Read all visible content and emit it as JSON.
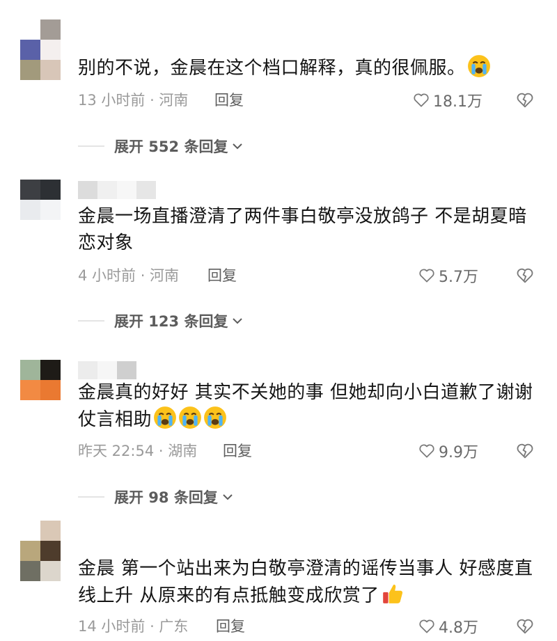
{
  "comments": [
    {
      "text": "别的不说，金晨在这个档口解释，真的很佩服。",
      "emojis": [
        "crying-face"
      ],
      "meta": "13 小时前 · 河南",
      "reply_label": "回复",
      "likes": "18.1万",
      "expand_label": "展开 552 条回复",
      "avatar_colors": [
        "#ffffff",
        "#a39c96",
        "#5a61a8",
        "#f4efee",
        "#a29a7c",
        "#d8c6b8"
      ]
    },
    {
      "text": "金晨一场直播澄清了两件事白敬亭没放鸽子 不是胡夏暗恋对象",
      "emojis": [],
      "meta": "4 小时前 · 河南",
      "reply_label": "回复",
      "likes": "5.7万",
      "expand_label": "展开 123 条回复",
      "avatar_colors": [
        "#3d3f43",
        "#2d3034",
        "#e9ebee",
        "#1b1e24"
      ]
    },
    {
      "text": "金晨真的好好 其实不关她的事 但她却向小白道歉了谢谢仗言相助",
      "emojis": [
        "crying-face",
        "crying-face",
        "crying-face"
      ],
      "meta": "昨天 22:54 · 湖南",
      "reply_label": "回复",
      "likes": "9.9万",
      "expand_label": "展开 98 条回复",
      "avatar_colors": [
        "#9fb59a",
        "#1e1b17",
        "#f28a43",
        "#ea7931"
      ]
    },
    {
      "text": "金晨 第一个站出来为白敬亭澄清的谣传当事人 好感度直线上升 从原来的有点抵触变成欣赏了",
      "emojis": [
        "thumbs-up"
      ],
      "meta": "14 小时前 · 广东",
      "reply_label": "回复",
      "likes": "4.8万",
      "avatar_colors": [
        "#ffffff",
        "#dac8b6",
        "#b9a77c",
        "#4e3c2c",
        "#6f6f63",
        "#dcd6cc"
      ]
    }
  ],
  "icons": {
    "like": "heart-outline-icon",
    "dislike": "broken-heart-icon",
    "expand": "chevron-down-icon"
  }
}
